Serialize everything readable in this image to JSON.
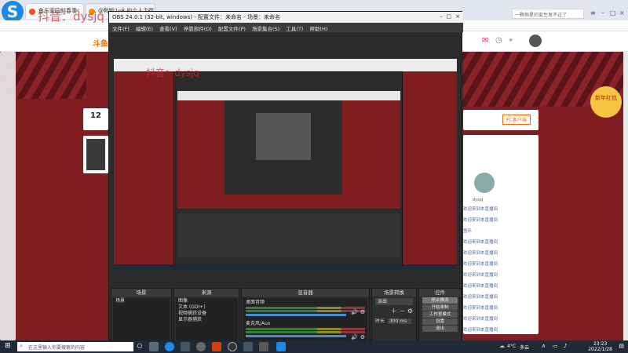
{
  "browser": {
    "tabs": [
      {
        "title": "鱼乐家园斜春事",
        "color": "#f4511e"
      },
      {
        "title": "@鸭鸭1v8 的个人主页",
        "color": "#fb8c00"
      }
    ],
    "bookmarks": [
      "收藏",
      "导航",
      "热门"
    ],
    "search_placeholder": "一颗恒星的诞生发不过了"
  },
  "site": {
    "brand": "斗鱼",
    "pc_client": "PC客户端",
    "promo_badge": "新年红包",
    "side_count": "12",
    "profile_name": "dysjq"
  },
  "watermark": "抖音：dysjq",
  "obs": {
    "title": "OBS 24.0.1 (32-bit, windows) - 配置文件：未命名 - 场景：未命名",
    "menu": [
      "文件(F)",
      "编辑(E)",
      "查看(V)",
      "停靠部件(D)",
      "配置文件(P)",
      "场景集合(S)",
      "工具(T)",
      "帮助(H)"
    ],
    "docks": {
      "scenes": {
        "title": "场景",
        "items": [
          "场景"
        ]
      },
      "sources": {
        "title": "来源",
        "items": [
          "图像",
          "文本 (GDI+)",
          "视频捕获设备",
          "显示器捕获"
        ]
      },
      "mixer": {
        "title": "混音器",
        "channels": [
          "桌面音频",
          "麦克风/Aux"
        ]
      },
      "transitions": {
        "title": "场景转换",
        "type": "淡出",
        "duration_label": "时长",
        "duration": "300 ms"
      },
      "controls": {
        "title": "控件",
        "buttons": [
          "停止推流",
          "开始录制",
          "工作室模式",
          "设置",
          "退出"
        ]
      }
    }
  },
  "feed": [
    "欢迎来到本直播间",
    "欢迎来到本直播间",
    "鱼乐",
    "欢迎来到本直播间",
    "欢迎来到本直播间",
    "欢迎来到本直播间",
    "欢迎来到本直播间",
    "欢迎来到本直播间",
    "欢迎来到本直播间",
    "欢迎来到本直播间",
    "欢迎来到本直播间",
    "欢迎来到本直播间"
  ],
  "taskbar": {
    "search_placeholder": "在这里输入你要搜索的内容",
    "time": "23:23",
    "date": "2022/1/28",
    "temperature": "4°C",
    "weather": "多云"
  }
}
